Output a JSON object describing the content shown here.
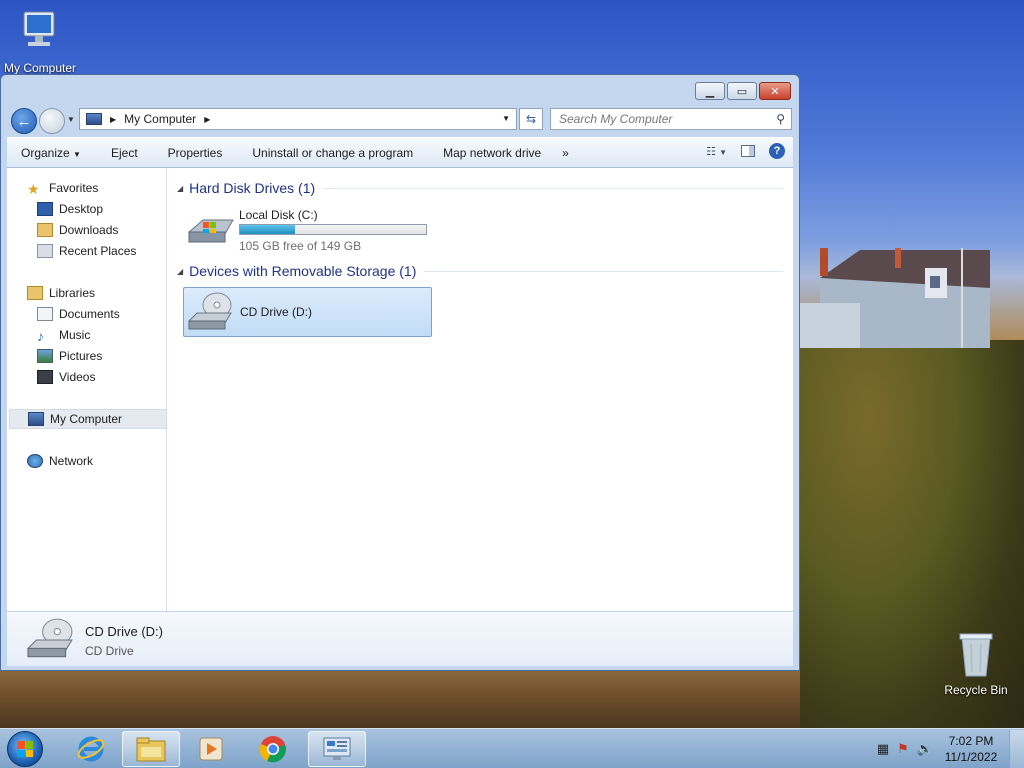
{
  "desktop": {
    "icons": [
      {
        "label": "My Computer"
      },
      {
        "label": "Recycle Bin"
      }
    ]
  },
  "window": {
    "title_buttons": {
      "minimize": "minimize",
      "maximize": "maximize",
      "close": "close"
    },
    "address": {
      "location": "My Computer"
    },
    "search": {
      "placeholder": "Search My Computer"
    },
    "toolbar": {
      "organize": "Organize",
      "eject": "Eject",
      "properties": "Properties",
      "uninstall": "Uninstall or change a program",
      "map_drive": "Map network drive",
      "more": "»"
    },
    "nav_pane": {
      "favorites": "Favorites",
      "desktop": "Desktop",
      "downloads": "Downloads",
      "recent_places": "Recent Places",
      "libraries": "Libraries",
      "documents": "Documents",
      "music": "Music",
      "pictures": "Pictures",
      "videos": "Videos",
      "my_computer": "My Computer",
      "network": "Network"
    },
    "content": {
      "hdd_group": "Hard Disk Drives (1)",
      "removable_group": "Devices with Removable Storage (1)",
      "local_disk": {
        "name": "Local Disk (C:)",
        "free_text": "105 GB free of 149 GB",
        "used_fraction": 0.295
      },
      "cd_drive": {
        "name": "CD Drive (D:)"
      }
    },
    "details": {
      "name": "CD Drive (D:)",
      "type": "CD Drive"
    }
  },
  "taskbar": {
    "clock_time": "7:02 PM",
    "clock_date": "11/1/2022"
  }
}
